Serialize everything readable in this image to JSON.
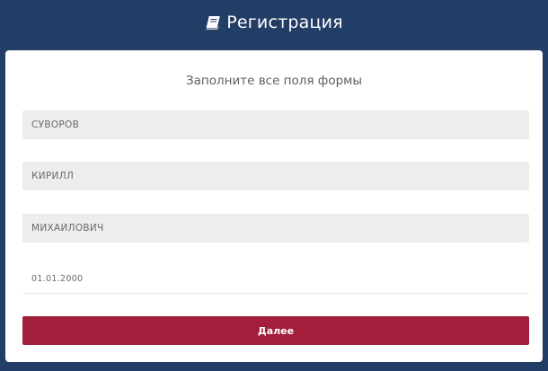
{
  "header": {
    "title": "Регистрация",
    "icon": "book-icon"
  },
  "form": {
    "subtitle": "Заполните все поля формы",
    "fields": [
      {
        "name": "last-name",
        "value": "СУВОРОВ"
      },
      {
        "name": "first-name",
        "value": "КИРИЛЛ"
      },
      {
        "name": "middle-name",
        "value": "МИХАЙЛОВИЧ"
      },
      {
        "name": "birth-date",
        "value": "01.01.2000"
      }
    ],
    "submit_label": "Далее"
  },
  "colors": {
    "background": "#223d66",
    "button": "#a21e3a",
    "field_fill": "#ededed"
  }
}
